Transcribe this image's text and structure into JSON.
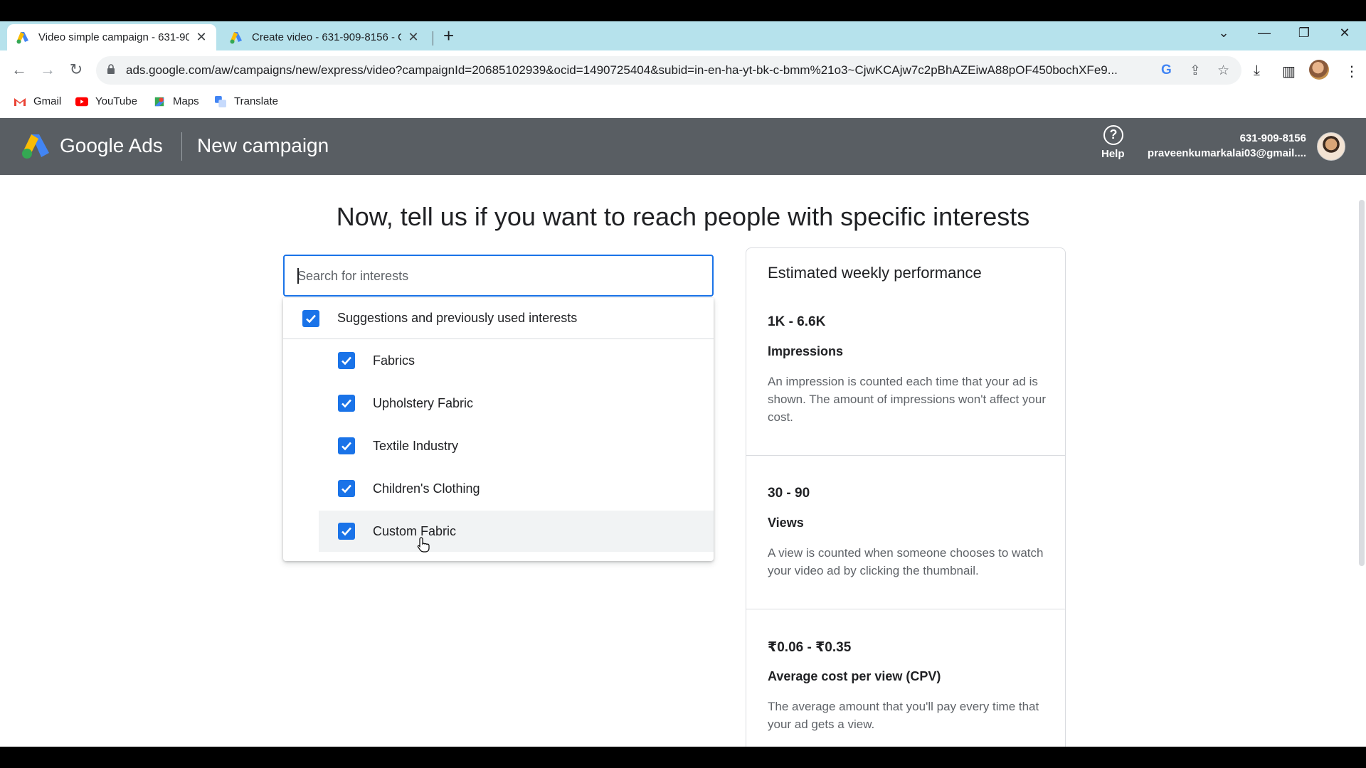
{
  "browser": {
    "tabs": [
      {
        "title": "Video simple campaign - 631-90",
        "active": true
      },
      {
        "title": "Create video - 631-909-8156 - G",
        "active": false
      }
    ],
    "url": "ads.google.com/aw/campaigns/new/express/video?campaignId=20685102939&ocid=1490725404&subid=in-en-ha-yt-bk-c-bmm%21o3~CjwKCAjw7c2pBhAZEiwA88pOF450bochXFe9...",
    "bookmarks": [
      "Gmail",
      "YouTube",
      "Maps",
      "Translate"
    ]
  },
  "header": {
    "brand": "Google Ads",
    "page_title": "New campaign",
    "help_label": "Help",
    "account_id": "631-909-8156",
    "account_email": "praveenkumarkalai03@gmail...."
  },
  "main": {
    "heading": "Now, tell us if you want to reach people with specific interests",
    "search_placeholder": "Search for interests",
    "parent_option": {
      "label": "Suggestions and previously used interests",
      "checked": true
    },
    "options": [
      {
        "label": "Fabrics",
        "checked": true
      },
      {
        "label": "Upholstery Fabric",
        "checked": true
      },
      {
        "label": "Textile Industry",
        "checked": true
      },
      {
        "label": "Children's Clothing",
        "checked": true
      },
      {
        "label": "Custom Fabric",
        "checked": true
      }
    ]
  },
  "performance": {
    "title": "Estimated weekly performance",
    "metrics": [
      {
        "value": "1K - 6.6K",
        "label": "Impressions",
        "description": "An impression is counted each time that your ad is shown. The amount of impressions won't affect your cost."
      },
      {
        "value": "30 - 90",
        "label": "Views",
        "description": "A view is counted when someone chooses to watch your video ad by clicking the thumbnail."
      },
      {
        "value": "₹0.06 - ₹0.35",
        "label": "Average cost per view (CPV)",
        "description": "The average amount that you'll pay every time that your ad gets a view."
      }
    ]
  },
  "colors": {
    "accent": "#1a73e8",
    "header_bg": "#595e63",
    "tabstrip_bg": "#b6e2ec"
  }
}
